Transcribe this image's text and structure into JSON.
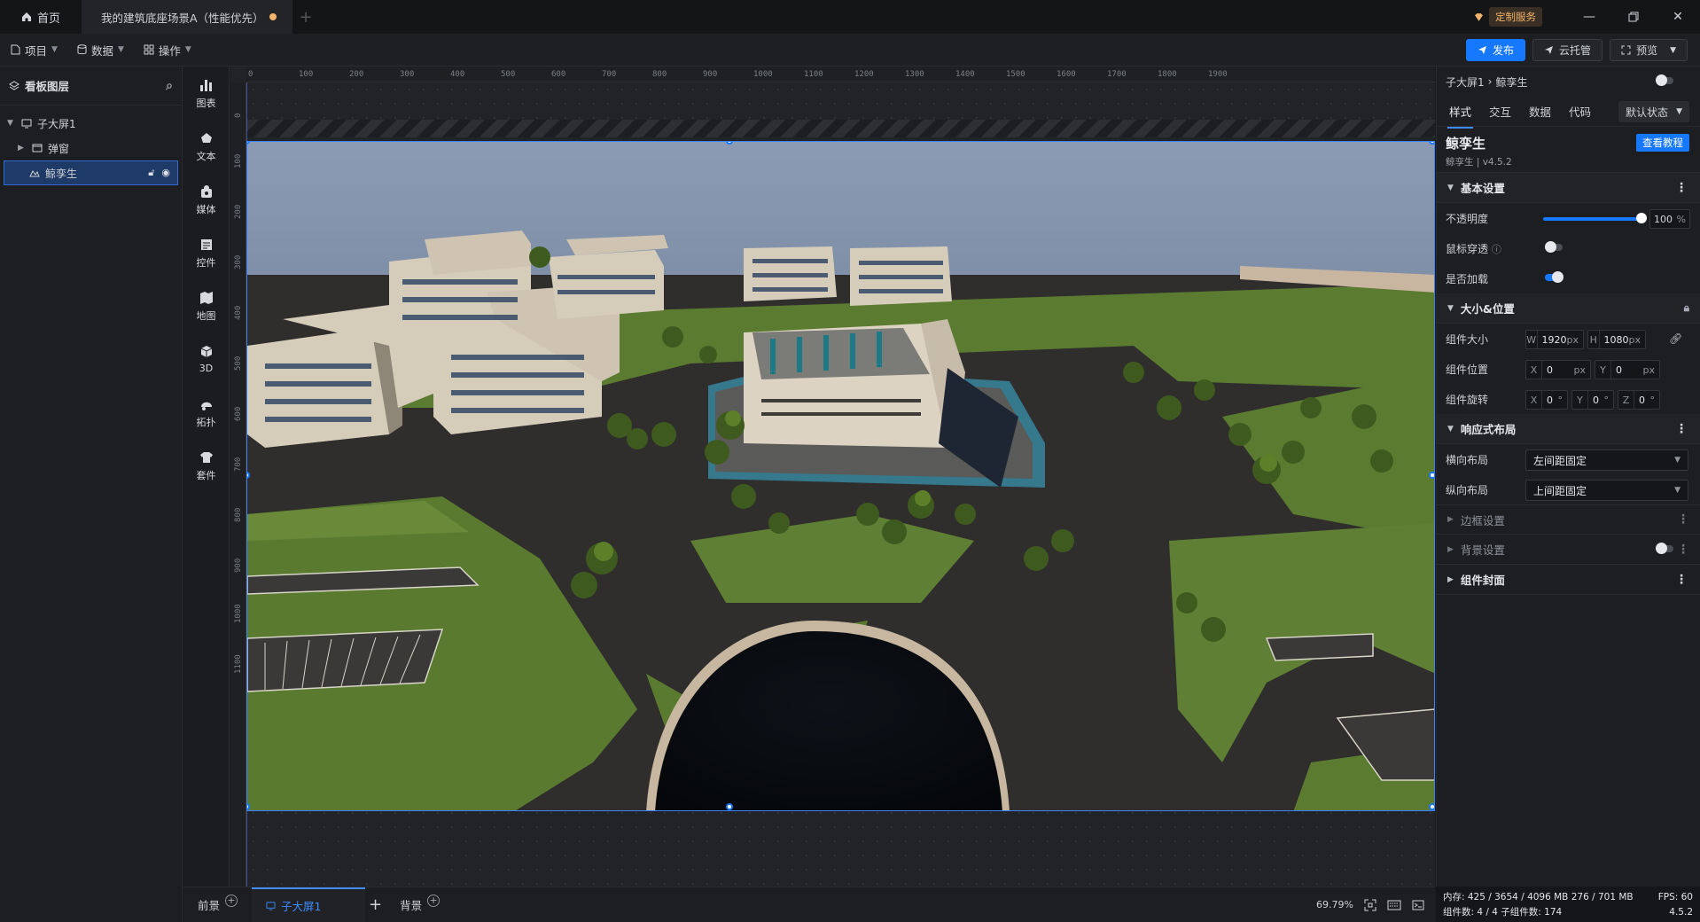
{
  "titlebar": {
    "home_tab": "首页",
    "doc_tab": "我的建筑底座场景A（性能优先）",
    "custom_service": "定制服务"
  },
  "toolbar": {
    "menus": [
      "项目",
      "数据",
      "操作"
    ],
    "publish": "发布",
    "cloud_host": "云托管",
    "preview": "预览"
  },
  "layers": {
    "title": "看板图层",
    "items": [
      {
        "label": "子大屏1"
      },
      {
        "label": "弹窗"
      },
      {
        "label": "鲸孪生"
      }
    ]
  },
  "rail": {
    "items": [
      {
        "label": "图表",
        "icon": "bar-chart-icon"
      },
      {
        "label": "文本",
        "icon": "text-icon"
      },
      {
        "label": "媒体",
        "icon": "media-icon"
      },
      {
        "label": "控件",
        "icon": "control-icon"
      },
      {
        "label": "地图",
        "icon": "map-icon"
      },
      {
        "label": "3D",
        "icon": "cube-icon"
      },
      {
        "label": "拓扑",
        "icon": "topology-icon"
      },
      {
        "label": "套件",
        "icon": "kit-icon"
      }
    ]
  },
  "ruler": {
    "h": [
      "0",
      "100",
      "200",
      "300",
      "400",
      "500",
      "600",
      "700",
      "800",
      "900",
      "1000",
      "1100",
      "1200",
      "1300",
      "1400",
      "1500",
      "1600",
      "1700",
      "1800",
      "1900"
    ],
    "v": [
      "0",
      "100",
      "200",
      "300",
      "400",
      "500",
      "600",
      "700",
      "800",
      "900",
      "1000",
      "1100"
    ]
  },
  "bottom": {
    "tabs": [
      "前景",
      "子大屏1",
      "背景"
    ],
    "zoom": "69.79%"
  },
  "props": {
    "breadcrumb": [
      "子大屏1",
      "鲸孪生"
    ],
    "tabs": [
      "样式",
      "交互",
      "数据",
      "代码"
    ],
    "state": "默认状态",
    "component_name": "鲸孪生",
    "component_version": "鲸孪生 | v4.5.2",
    "tutorial": "查看教程",
    "sections": {
      "basic": "基本设置",
      "size_pos": "大小&位置",
      "responsive": "响应式布局",
      "border": "边框设置",
      "background": "背景设置",
      "cover": "组件封面"
    },
    "opacity_label": "不透明度",
    "opacity_value": "100",
    "opacity_unit": "%",
    "mouse_through_label": "鼠标穿透",
    "lazy_load_label": "是否加载",
    "size_label": "组件大小",
    "size_w": "1920",
    "size_h": "1080",
    "pos_label": "组件位置",
    "pos_x": "0",
    "pos_y": "0",
    "rot_label": "组件旋转",
    "rot_x": "0",
    "rot_y": "0",
    "rot_z": "0",
    "h_layout_label": "横向布局",
    "h_layout_value": "左间距固定",
    "v_layout_label": "纵向布局",
    "v_layout_value": "上间距固定",
    "unit_px": "px",
    "unit_deg": "°"
  },
  "status": {
    "memory": "内存:  425 / 3654 / 4096 MB  276 / 701 MB",
    "fps": "FPS:  60",
    "components": "组件数: 4 / 4    子组件数: 174",
    "version": "4.5.2"
  },
  "colors": {
    "accent": "#1677ff",
    "sky": "#8596b0",
    "road": "#2e2d2c",
    "grass": "#5f7f34"
  }
}
